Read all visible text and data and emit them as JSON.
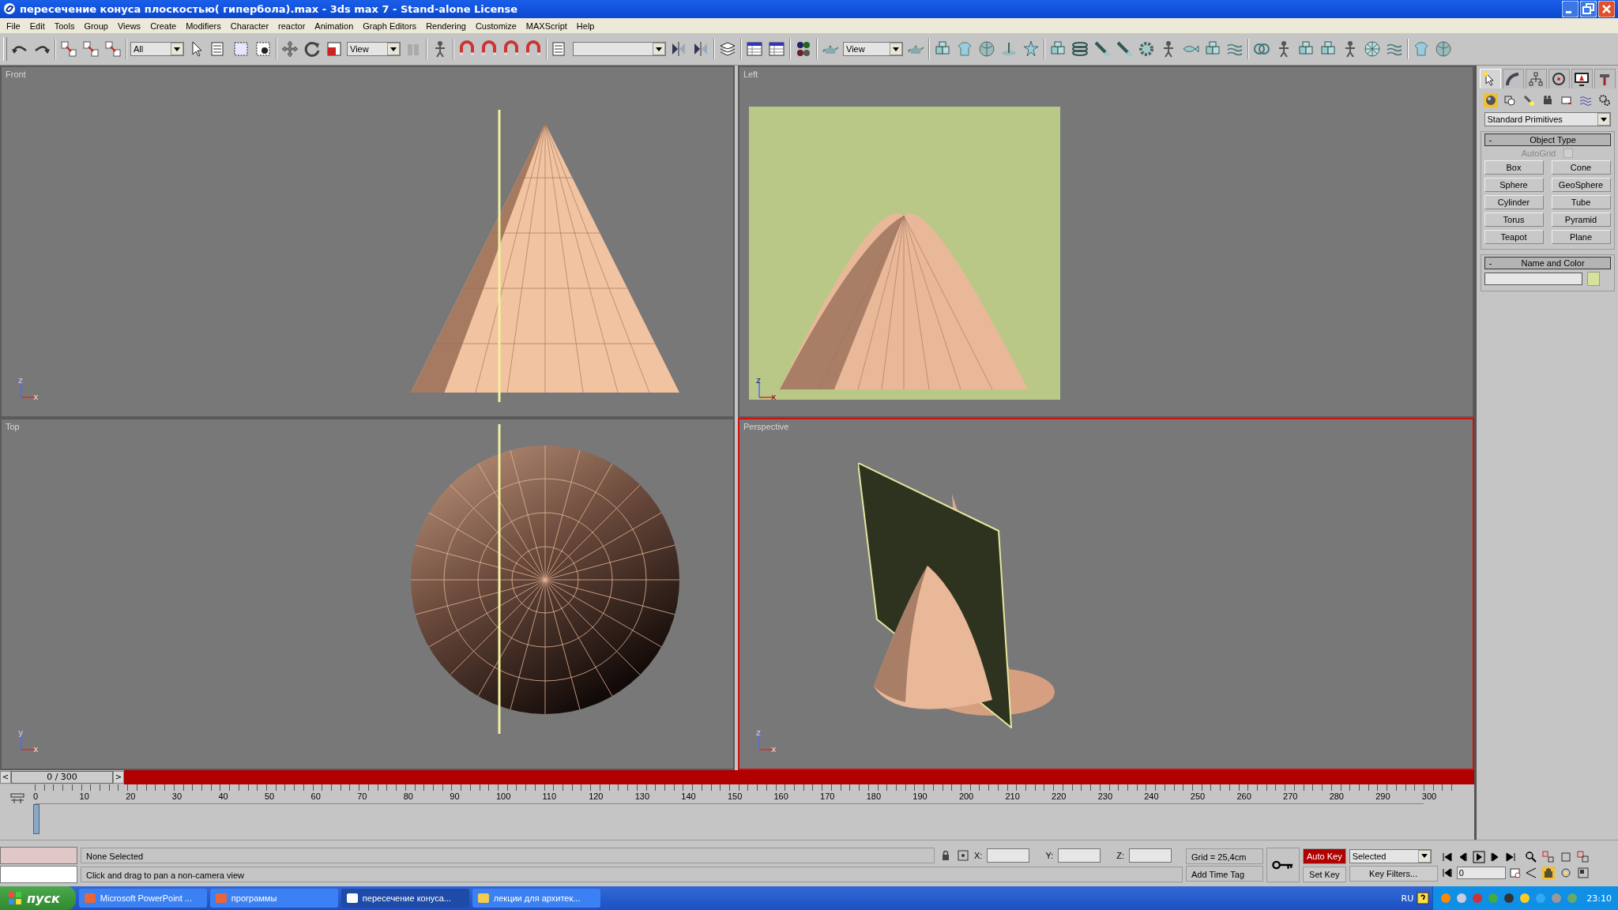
{
  "window": {
    "title": "пересечение конуса плоскостью( гипербола).max - 3ds max 7  - Stand-alone License"
  },
  "menu": [
    "File",
    "Edit",
    "Tools",
    "Group",
    "Views",
    "Create",
    "Modifiers",
    "Character",
    "reactor",
    "Animation",
    "Graph Editors",
    "Rendering",
    "Customize",
    "MAXScript",
    "Help"
  ],
  "toolbar": {
    "selection_filter": "All",
    "reference_coord": "View",
    "render_view": "View"
  },
  "viewports": [
    {
      "label": "Front",
      "kind": "front",
      "active": false,
      "axes": [
        "z",
        "x"
      ]
    },
    {
      "label": "Left",
      "kind": "left",
      "active": false,
      "axes": [
        "z",
        "x"
      ]
    },
    {
      "label": "Top",
      "kind": "top",
      "active": false,
      "axes": [
        "y",
        "x"
      ]
    },
    {
      "label": "Perspective",
      "kind": "perspective",
      "active": true,
      "axes": [
        "z",
        "x"
      ]
    }
  ],
  "command_panel": {
    "tabs": [
      {
        "selected": true
      },
      {
        "selected": false
      },
      {
        "selected": false
      },
      {
        "selected": false
      },
      {
        "selected": false
      },
      {
        "selected": false
      }
    ],
    "categories": [
      {
        "selected": true
      },
      {
        "selected": false
      },
      {
        "selected": false
      },
      {
        "selected": false
      },
      {
        "selected": false
      },
      {
        "selected": false
      },
      {
        "selected": false
      }
    ],
    "dropdown": "Standard Primitives",
    "object_type": {
      "toggle": "-",
      "title": "Object Type",
      "autogrid": {
        "label": "AutoGrid",
        "checked": false,
        "disabled": true
      },
      "buttons": [
        "Box",
        "Cone",
        "Sphere",
        "GeoSphere",
        "Cylinder",
        "Tube",
        "Torus",
        "Pyramid",
        "Teapot",
        "Plane"
      ]
    },
    "name_and_color": {
      "toggle": "-",
      "title": "Name and Color",
      "color": "#d6e29b"
    }
  },
  "time_slider": {
    "prev": "<",
    "label": "0 / 300",
    "next": ">",
    "level": 0
  },
  "track_bar": {
    "ticks": [
      "0",
      "10",
      "20",
      "30",
      "40",
      "50",
      "60",
      "70",
      "80",
      "90",
      "100",
      "110",
      "120",
      "130",
      "140",
      "150",
      "160",
      "170",
      "180",
      "190",
      "200",
      "210",
      "220",
      "230",
      "240",
      "250",
      "260",
      "270",
      "280",
      "290",
      "300"
    ]
  },
  "status": {
    "selection": "None Selected",
    "prompt": "Click and drag to pan a non-camera view",
    "x_label": "X:",
    "y_label": "Y:",
    "z_label": "Z:",
    "grid": "Grid = 25,4cm",
    "add_time_tag": "Add Time Tag",
    "auto_key": {
      "label": "Auto Key",
      "on": true
    },
    "set_key": "Set Key",
    "key_mode": "Selected",
    "key_filters": "Key Filters...",
    "frame": "0"
  },
  "taskbar": {
    "start": "пуск",
    "tasks": [
      {
        "label": "Microsoft PowerPoint ...",
        "selected": false
      },
      {
        "label": "программы",
        "selected": false
      },
      {
        "label": "пересечение конуса...",
        "selected": true
      },
      {
        "label": "лекции для архитек...",
        "selected": false
      }
    ],
    "lang": "RU",
    "clock": "23:10"
  }
}
